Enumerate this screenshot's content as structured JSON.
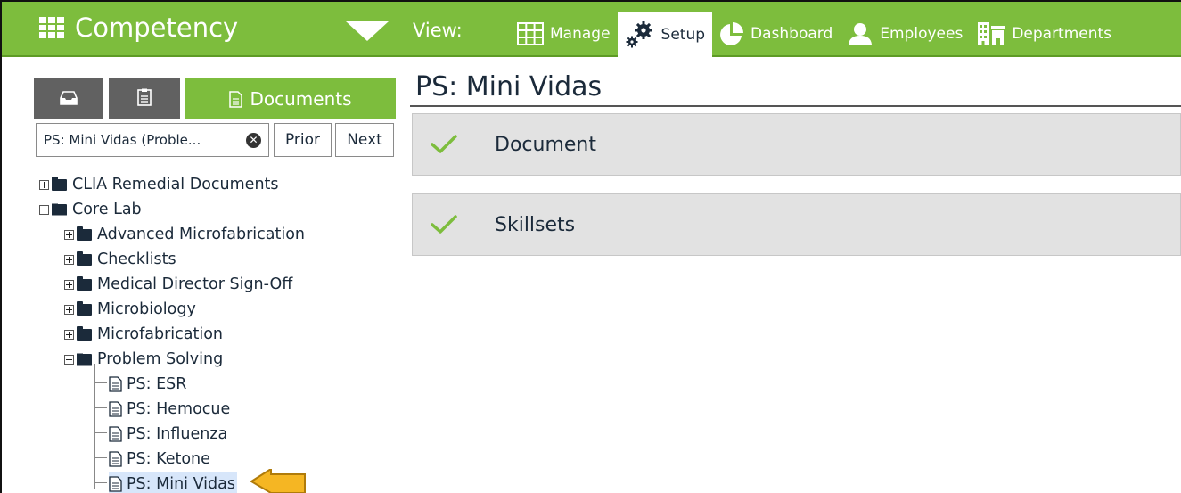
{
  "header": {
    "app_name": "Competency",
    "view_label": "View:",
    "nav": [
      {
        "label": "Manage",
        "icon": "grid-icon",
        "active": false
      },
      {
        "label": "Setup",
        "icon": "gears-icon",
        "active": true
      },
      {
        "label": "Dashboard",
        "icon": "pie-chart-icon",
        "active": false
      },
      {
        "label": "Employees",
        "icon": "person-icon",
        "active": false
      },
      {
        "label": "Departments",
        "icon": "building-icon",
        "active": false
      }
    ]
  },
  "sidebar": {
    "tabs": [
      {
        "icon": "inbox-icon",
        "label": ""
      },
      {
        "icon": "clipboard-icon",
        "label": ""
      },
      {
        "icon": "document-icon",
        "label": "Documents",
        "active": true
      }
    ],
    "search_value": "PS: Mini Vidas (Proble...",
    "prior_label": "Prior",
    "next_label": "Next",
    "tree": [
      {
        "label": "CLIA Remedial Documents",
        "type": "folder",
        "expanded": false,
        "level": 0
      },
      {
        "label": "Core Lab",
        "type": "folder",
        "expanded": true,
        "level": 0
      },
      {
        "label": "Advanced Microfabrication",
        "type": "folder",
        "expanded": false,
        "level": 1
      },
      {
        "label": "Checklists",
        "type": "folder",
        "expanded": false,
        "level": 1
      },
      {
        "label": "Medical Director Sign-Off",
        "type": "folder",
        "expanded": false,
        "level": 1
      },
      {
        "label": "Microbiology",
        "type": "folder",
        "expanded": false,
        "level": 1
      },
      {
        "label": "Microfabrication",
        "type": "folder",
        "expanded": false,
        "level": 1
      },
      {
        "label": "Problem Solving",
        "type": "folder",
        "expanded": true,
        "level": 1
      },
      {
        "label": "PS: ESR",
        "type": "document",
        "level": 2
      },
      {
        "label": "PS: Hemocue",
        "type": "document",
        "level": 2
      },
      {
        "label": "PS: Influenza",
        "type": "document",
        "level": 2
      },
      {
        "label": "PS: Ketone",
        "type": "document",
        "level": 2
      },
      {
        "label": "PS: Mini Vidas",
        "type": "document",
        "level": 2,
        "selected": true
      }
    ]
  },
  "main": {
    "title": "PS: Mini Vidas",
    "sections": [
      {
        "label": "Document",
        "status": "check-icon"
      },
      {
        "label": "Skillsets",
        "status": "check-icon"
      }
    ]
  },
  "colors": {
    "brand_green": "#7dbd3d",
    "tab_gray": "#616161",
    "panel_gray": "#e2e2e2",
    "text_navy": "#1b2a3a",
    "selected_bg": "#d7e6fa",
    "arrow_orange": "#f5b623"
  }
}
